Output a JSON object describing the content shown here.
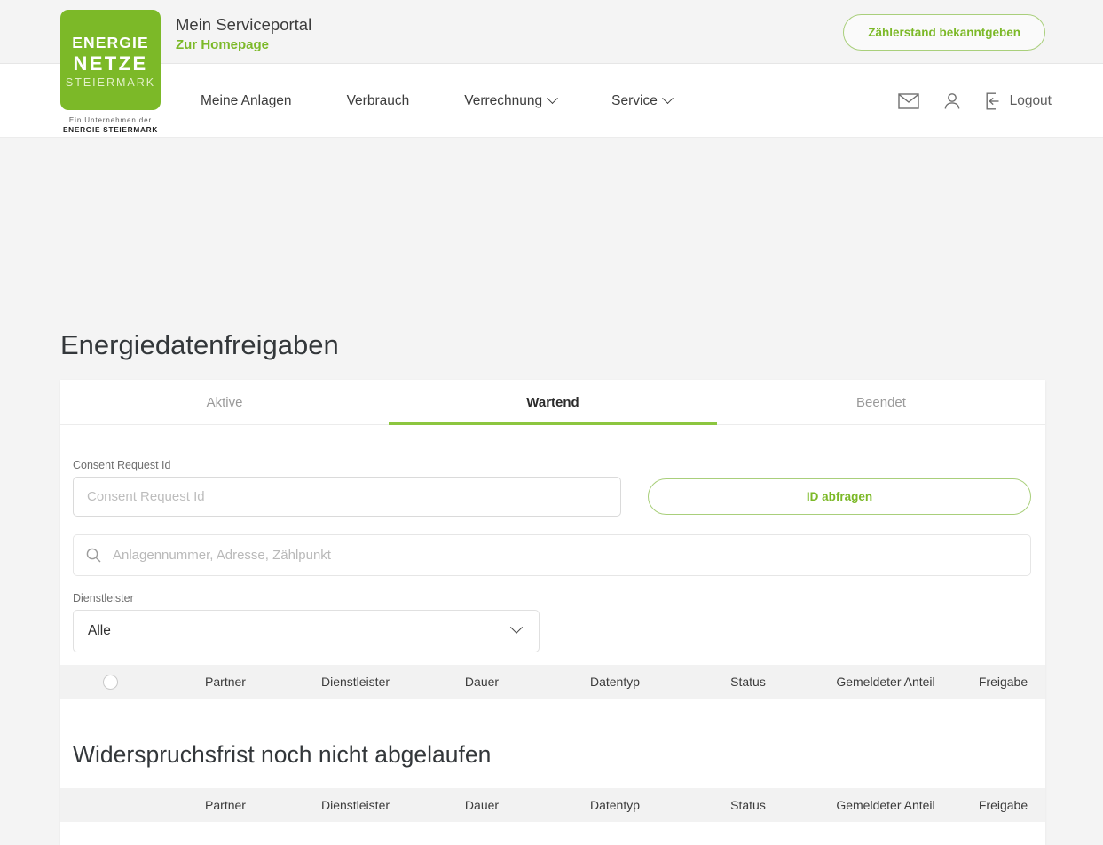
{
  "header": {
    "logo": {
      "line1": "ENERGIE",
      "line2": "NETZE",
      "line3": "STEIERMARK",
      "sub1": "Ein Unternehmen der",
      "sub2": "ENERGIE STEIERMARK"
    },
    "portal_title": "Mein Serviceportal",
    "homepage_link": "Zur Homepage",
    "cta_label": "Zählerstand bekanntgeben",
    "brand_green": "#7cb928"
  },
  "nav": {
    "items": [
      {
        "label": "Meine Anlagen",
        "has_chevron": false
      },
      {
        "label": "Verbrauch",
        "has_chevron": false
      },
      {
        "label": "Verrechnung",
        "has_chevron": true
      },
      {
        "label": "Service",
        "has_chevron": true
      }
    ],
    "mail_icon": "envelope-icon",
    "account_icon": "person-icon",
    "logout_icon": "logout-icon",
    "logout_label": "Logout"
  },
  "page": {
    "title": "Energiedatenfreigaben"
  },
  "tabs": [
    {
      "label": "Aktive",
      "active": false
    },
    {
      "label": "Wartend",
      "active": true
    },
    {
      "label": "Beendet",
      "active": false
    }
  ],
  "filters": {
    "consent_label": "Consent Request Id",
    "consent_placeholder": "Consent Request Id",
    "consent_value": "",
    "id_button_label": "ID abfragen",
    "search_placeholder": "Anlagennummer, Adresse, Zählpunkt",
    "search_value": "",
    "dienstleister_label": "Dienstleister",
    "dienstleister_selected": "Alle"
  },
  "table_primary": {
    "columns": [
      "Partner",
      "Dienstleister",
      "Dauer",
      "Datentyp",
      "Status",
      "Gemeldeter Anteil",
      "Freigabe"
    ],
    "select_all_control": "select-all-radio",
    "rows": []
  },
  "section_two": {
    "heading": "Widerspruchsfrist noch nicht abgelaufen",
    "columns": [
      "Partner",
      "Dienstleister",
      "Dauer",
      "Datentyp",
      "Status",
      "Gemeldeter Anteil",
      "Freigabe"
    ],
    "rows": []
  }
}
